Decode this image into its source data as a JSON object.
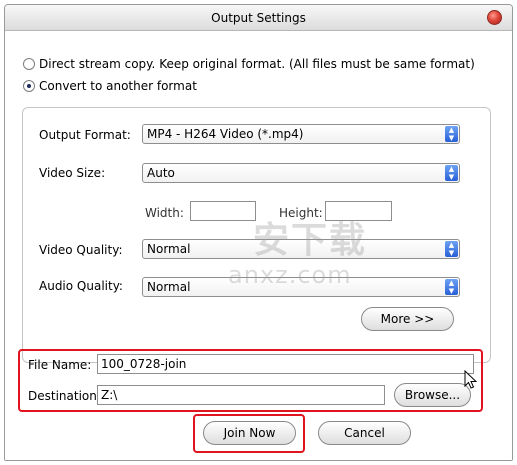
{
  "window": {
    "title": "Output Settings"
  },
  "mode": {
    "option_direct": "Direct stream copy. Keep original format. (All files must be same format)",
    "option_convert": "Convert to another format",
    "selected": "convert"
  },
  "format": {
    "output_format_label": "Output Format:",
    "output_format_value": "MP4 - H264 Video (*.mp4)",
    "video_size_label": "Video Size:",
    "video_size_value": "Auto",
    "width_label": "Width:",
    "width_value": "",
    "height_label": "Height:",
    "height_value": "",
    "video_quality_label": "Video Quality:",
    "video_quality_value": "Normal",
    "audio_quality_label": "Audio Quality:",
    "audio_quality_value": "Normal",
    "more_label": "More >>"
  },
  "output": {
    "file_name_label": "File Name:",
    "file_name_value": "100_0728-join",
    "destination_label": "Destination:",
    "destination_value": "Z:\\",
    "browse_label": "Browse..."
  },
  "actions": {
    "join_label": "Join Now",
    "cancel_label": "Cancel"
  },
  "watermark": {
    "cn": "安下载",
    "text": "anxz.com"
  },
  "colors": {
    "highlight": "#e0141e",
    "arrow": "#2860d6"
  }
}
